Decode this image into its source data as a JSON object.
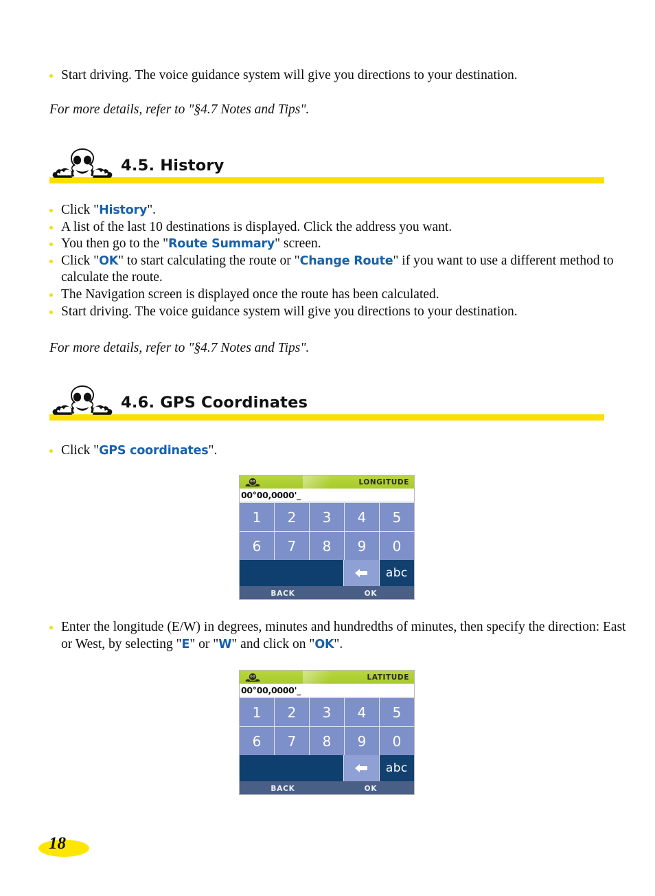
{
  "page": {
    "number": "18"
  },
  "intro": {
    "bullets": [
      "Start driving. The voice guidance system will give you directions to your destination."
    ],
    "note": "For more details, refer to \"§4.7 Notes and Tips\"."
  },
  "section_history": {
    "title": "4.5. History",
    "icon": "michelin-man-icon",
    "bullets": {
      "b1_pre": "Click \"",
      "b1_kw": "History",
      "b1_post": "\".",
      "b2": "A list of the last 10 destinations is displayed. Click the address you want.",
      "b3_pre": "You then go to the \"",
      "b3_kw": "Route Summary",
      "b3_post": "\" screen.",
      "b4_pre": "Click \"",
      "b4_kw1": "OK",
      "b4_mid": "\" to start calculating the route or \"",
      "b4_kw2": "Change Route",
      "b4_post": "\" if you want to use a different method to calculate the route.",
      "b5": "The Navigation screen is displayed once the route has been calculated.",
      "b6": "Start driving. The voice guidance system will give you directions to your destination."
    },
    "note": "For more details, refer to \"§4.7 Notes and Tips\"."
  },
  "section_gps": {
    "title": "4.6. GPS Coordinates",
    "icon": "michelin-man-icon",
    "bullet_click_pre": "Click \"",
    "bullet_click_kw": "GPS coordinates",
    "bullet_click_post": "\".",
    "longitude_instruction": {
      "pre": "Enter the longitude (E/W) in degrees, minutes and hundredths of minutes, then specify the direction: East or West, by selecting \"",
      "kw1": "E",
      "mid": "\" or \"",
      "kw2": "W",
      "mid2": "\" and click on \"",
      "kw3": "OK",
      "post": "\"."
    }
  },
  "device_longitude": {
    "title": "LONGITUDE",
    "icon": "michelin-head-icon",
    "input_value": "00°00,0000'_",
    "keys_row1": [
      "1",
      "2",
      "3",
      "4",
      "5"
    ],
    "keys_row2": [
      "6",
      "7",
      "8",
      "9",
      "0"
    ],
    "backspace_icon": "backspace-arrow-icon",
    "abc_label": "abc",
    "back_label": "BACK",
    "ok_label": "OK"
  },
  "device_latitude": {
    "title": "LATITUDE",
    "icon": "michelin-head-icon",
    "input_value": "00°00,0000'_",
    "keys_row1": [
      "1",
      "2",
      "3",
      "4",
      "5"
    ],
    "keys_row2": [
      "6",
      "7",
      "8",
      "9",
      "0"
    ],
    "backspace_icon": "backspace-arrow-icon",
    "abc_label": "abc",
    "back_label": "BACK",
    "ok_label": "OK"
  },
  "colors": {
    "accent_yellow": "#fcdf00",
    "link_blue": "#1761ab",
    "device_titlebar_green": "#b4d33a",
    "key_blue": "#7e90c9",
    "dark_navy": "#12406f",
    "footer_slate": "#4a5f86",
    "page_badge_yellow": "#ffe600"
  }
}
